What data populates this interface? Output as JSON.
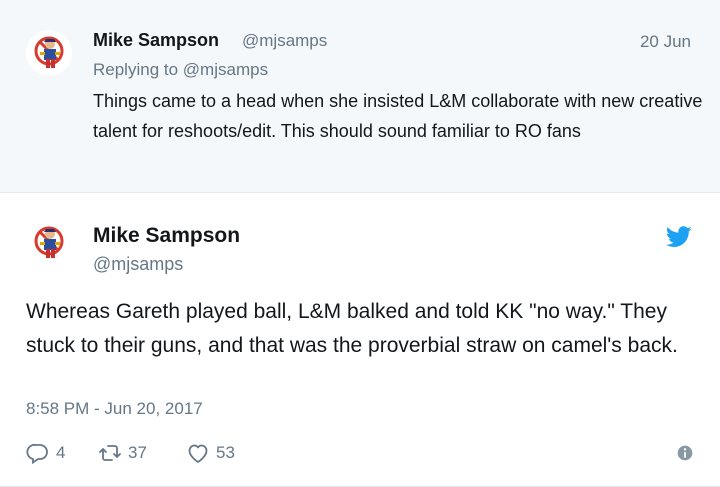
{
  "parent_tweet": {
    "author_name": "Mike Sampson",
    "author_handle": "@mjsamps",
    "date": "20 Jun",
    "reply_prefix": "Replying to",
    "reply_handle": "@mjsamps",
    "text": "Things came to a head when she insisted L&M collaborate with new creative talent for reshoots/edit. This should sound familiar to RO fans"
  },
  "main_tweet": {
    "author_name": "Mike Sampson",
    "author_handle": "@mjsamps",
    "text": "Whereas Gareth played ball, L&M balked and told KK \"no way.\" They stuck to their guns, and that was the proverbial straw on camel's back.",
    "timestamp": "8:58 PM - Jun 20, 2017",
    "replies": "4",
    "retweets": "37",
    "likes": "53"
  },
  "colors": {
    "accent": "#1da1f2",
    "muted": "#657786",
    "text": "#14171a",
    "parent_bg": "#f5f8fa"
  },
  "icons": [
    "avatar",
    "twitter-bird-icon",
    "reply-icon",
    "retweet-icon",
    "heart-icon",
    "info-icon"
  ]
}
